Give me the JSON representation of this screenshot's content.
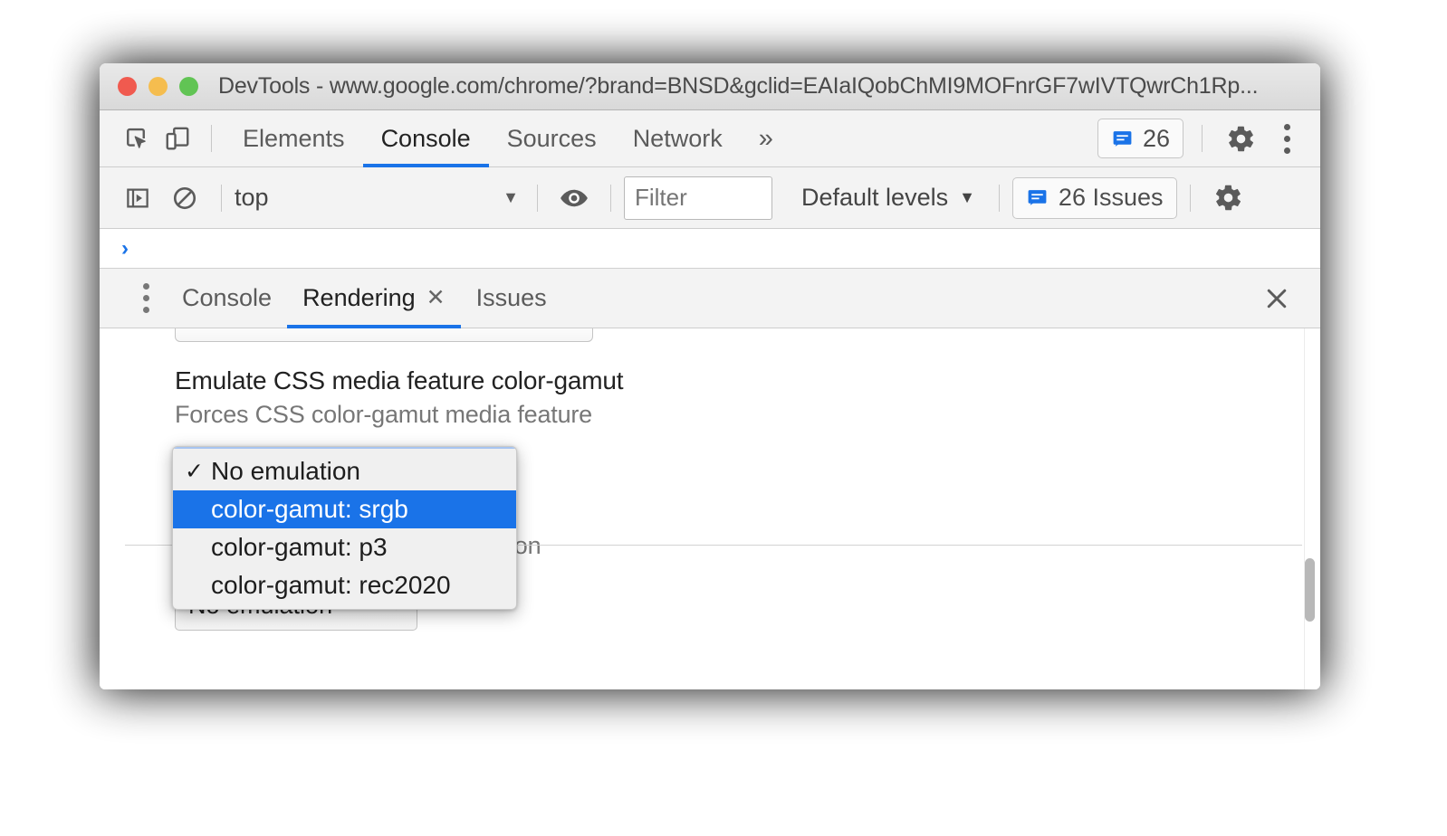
{
  "window": {
    "title": "DevTools - www.google.com/chrome/?brand=BNSD&gclid=EAIaIQobChMI9MOFnrGF7wIVTQwrCh1Rp...",
    "traffic_lights": [
      "close-red",
      "minimize-yellow",
      "zoom-green"
    ]
  },
  "main_toolbar": {
    "inspect_icon": "inspect-element-icon",
    "device_icon": "device-toolbar-icon",
    "tabs": [
      {
        "label": "Elements",
        "active": false
      },
      {
        "label": "Console",
        "active": true
      },
      {
        "label": "Sources",
        "active": false
      },
      {
        "label": "Network",
        "active": false
      }
    ],
    "more_tabs_label": "»",
    "issues_count": "26",
    "issues_icon": "issues-message-icon",
    "settings_icon": "gear-icon",
    "menu_icon": "kebab-menu-icon",
    "accent": "#1a73e8"
  },
  "console_toolbar": {
    "sidebar_icon": "console-sidebar-icon",
    "clear_icon": "clear-console-icon",
    "context_value": "top",
    "context_caret": "▼",
    "eye_icon": "live-expression-eye-icon",
    "filter_placeholder": "Filter",
    "filter_value": "",
    "levels_label": "Default levels",
    "levels_caret": "▼",
    "issues_label": "26 Issues",
    "issues_icon": "issues-message-icon",
    "settings_icon": "gear-icon"
  },
  "console_prompt": {
    "chevron": "›"
  },
  "drawer": {
    "menu_icon": "kebab-menu-icon",
    "tabs": [
      {
        "label": "Console",
        "active": false,
        "closable": false
      },
      {
        "label": "Rendering",
        "active": true,
        "closable": true,
        "close_glyph": "✕"
      },
      {
        "label": "Issues",
        "active": false,
        "closable": false
      }
    ],
    "close_glyph": "✕",
    "close_name": "close-drawer-icon"
  },
  "rendering_panel": {
    "color_gamut": {
      "title": "Emulate CSS media feature color-gamut",
      "description": "Forces CSS color-gamut media feature",
      "select_value": "No emulation",
      "caret": "▼"
    },
    "vision_deficiency": {
      "description": "Forces vision deficiency emulation",
      "select_value": "No emulation",
      "caret": "▼"
    }
  },
  "dropdown_popup": {
    "check_glyph": "✓",
    "options": [
      {
        "label": "No emulation",
        "checked": true,
        "highlighted": false
      },
      {
        "label": "color-gamut: srgb",
        "checked": false,
        "highlighted": true
      },
      {
        "label": "color-gamut: p3",
        "checked": false,
        "highlighted": false
      },
      {
        "label": "color-gamut: rec2020",
        "checked": false,
        "highlighted": false
      }
    ],
    "highlight_color": "#1a73e8"
  }
}
